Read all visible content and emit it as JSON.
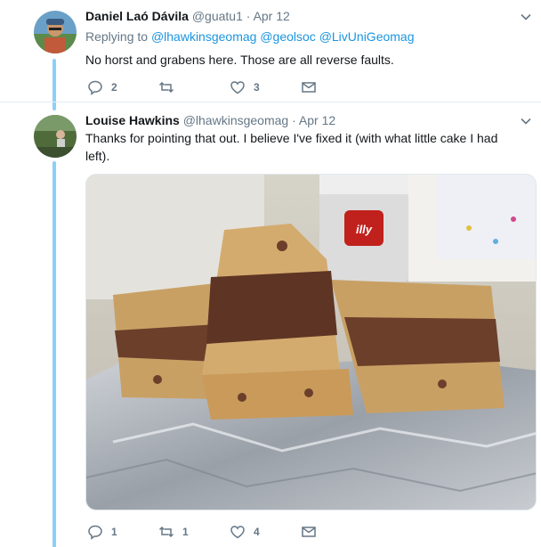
{
  "colors": {
    "link": "#1b95e0",
    "muted": "#657786",
    "thread": "#8dd0f5"
  },
  "tweets": [
    {
      "fullname": "Daniel Laó Dávila",
      "handle": "@guatu1",
      "separator": "·",
      "date": "Apr 12",
      "replying_label": "Replying to",
      "mentions": [
        "@lhawkinsgeomag",
        "@geolsoc",
        "@LivUniGeomag"
      ],
      "text": "No horst and grabens here. Those are all reverse faults.",
      "replies": "2",
      "retweets": "",
      "likes": "3"
    },
    {
      "fullname": "Louise Hawkins",
      "handle": "@lhawkinsgeomag",
      "separator": "·",
      "date": "Apr 12",
      "text": "Thanks for pointing that out. I believe I've fixed it (with what little cake I had left).",
      "media_label": "illy",
      "replies": "1",
      "retweets": "1",
      "likes": "4"
    }
  ],
  "icons": [
    "avatar",
    "chevron-down-icon",
    "reply-icon",
    "retweet-icon",
    "like-icon",
    "dm-icon"
  ]
}
